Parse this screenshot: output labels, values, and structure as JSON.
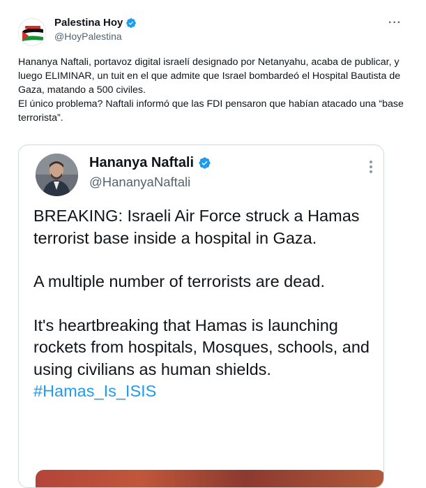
{
  "outer_tweet": {
    "author_name": "Palestina Hoy",
    "handle": "@HoyPalestina",
    "avatar_text": "PALESTINA HOY",
    "more_label": "···",
    "body_lines": [
      "Hananya Naftali, portavoz digital israelí designado por Netanyahu, acaba de publicar, y luego ELIMINAR, un tuit en el que admite que Israel bombardeó el Hospital Bautista de Gaza, matando a 500 civiles.",
      "El único problema?  Naftali informó que las FDI pensaron que habían atacado una “base terrorista”."
    ]
  },
  "quoted_tweet": {
    "author_name": "Hananya Naftali",
    "handle": "@HananyaNaftali",
    "paragraphs": [
      "BREAKING: Israeli Air Force struck a Hamas terrorist base inside a hospital in Gaza.",
      "A multiple number of terrorists are dead."
    ],
    "last_paragraph_text": "It's heartbreaking that Hamas is launching rockets from hospitals, Mosques, schools, and using civilians as human shields. ",
    "hashtag": "#Hamas_Is_ISIS"
  },
  "colors": {
    "verified": "#1d9bf0",
    "hashtag": "#1d9bf0",
    "secondary_text": "#536471"
  }
}
